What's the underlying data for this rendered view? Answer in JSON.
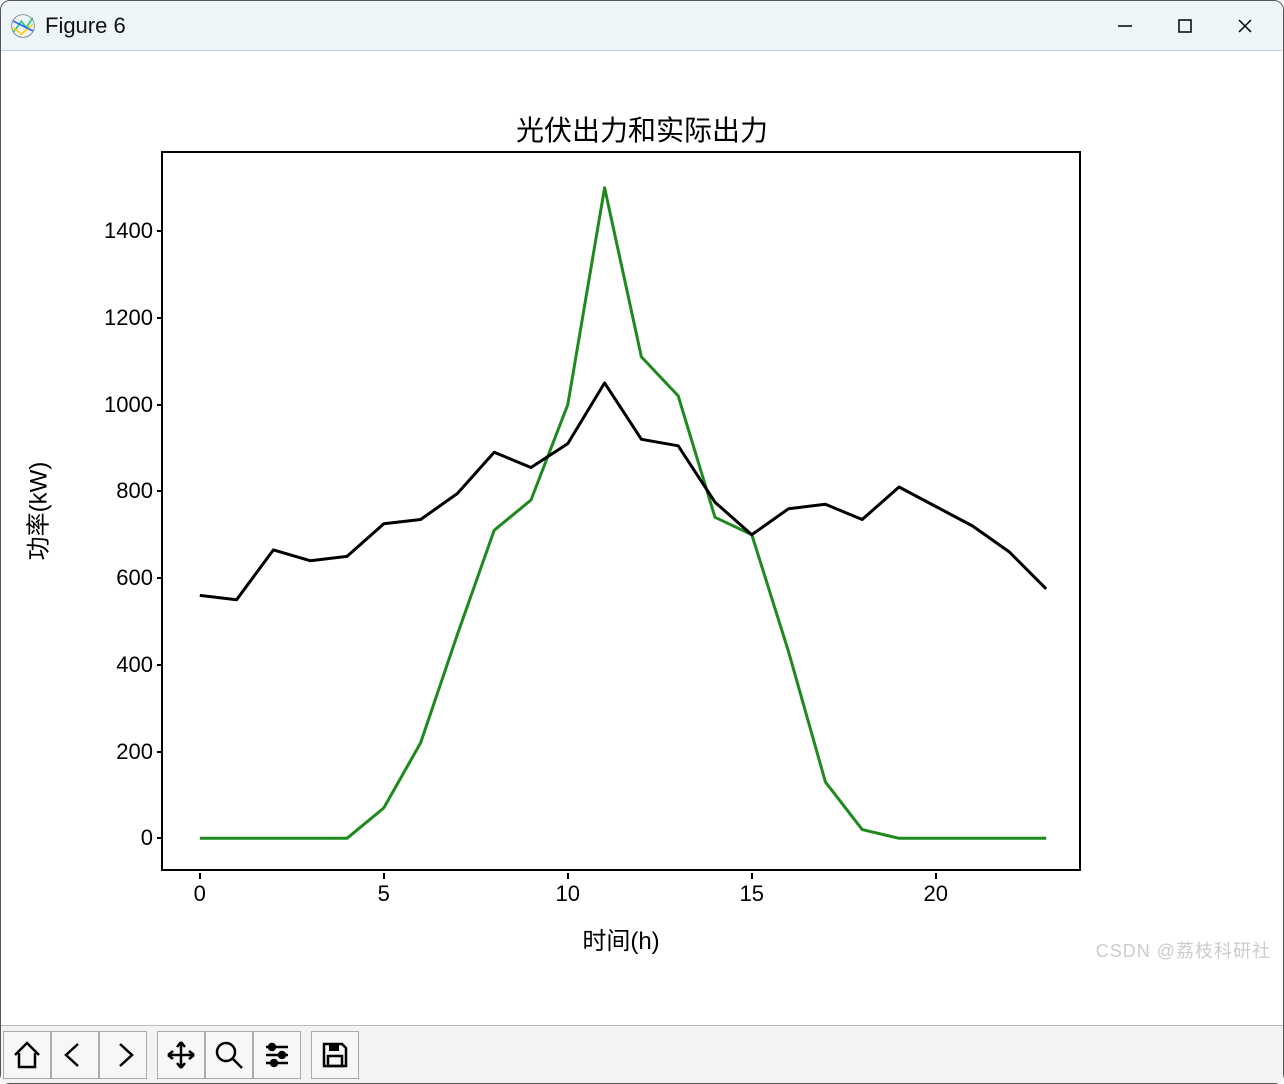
{
  "window": {
    "title": "Figure 6"
  },
  "watermark": "CSDN @荔枝科研社",
  "chart_data": {
    "type": "line",
    "title": "光伏出力和实际出力",
    "xlabel": "时间(h)",
    "ylabel": "功率(kW)",
    "xlim": [
      -1,
      24
    ],
    "ylim": [
      -80,
      1580
    ],
    "xticks": [
      0,
      5,
      10,
      15,
      20
    ],
    "yticks": [
      0,
      200,
      400,
      600,
      800,
      1000,
      1200,
      1400
    ],
    "x": [
      0,
      1,
      2,
      3,
      4,
      5,
      6,
      7,
      8,
      9,
      10,
      11,
      12,
      13,
      14,
      15,
      16,
      17,
      18,
      19,
      20,
      21,
      22,
      23
    ],
    "series": [
      {
        "name": "光伏出力",
        "color": "#1e8a1e",
        "values": [
          0,
          0,
          0,
          0,
          0,
          70,
          220,
          470,
          710,
          780,
          1000,
          1500,
          1110,
          1020,
          740,
          700,
          430,
          130,
          20,
          0,
          0,
          0,
          0,
          0
        ]
      },
      {
        "name": "实际出力",
        "color": "#000000",
        "values": [
          560,
          550,
          665,
          640,
          650,
          725,
          735,
          795,
          890,
          855,
          910,
          1050,
          920,
          905,
          775,
          700,
          760,
          770,
          735,
          810,
          765,
          720,
          660,
          575
        ]
      }
    ]
  }
}
